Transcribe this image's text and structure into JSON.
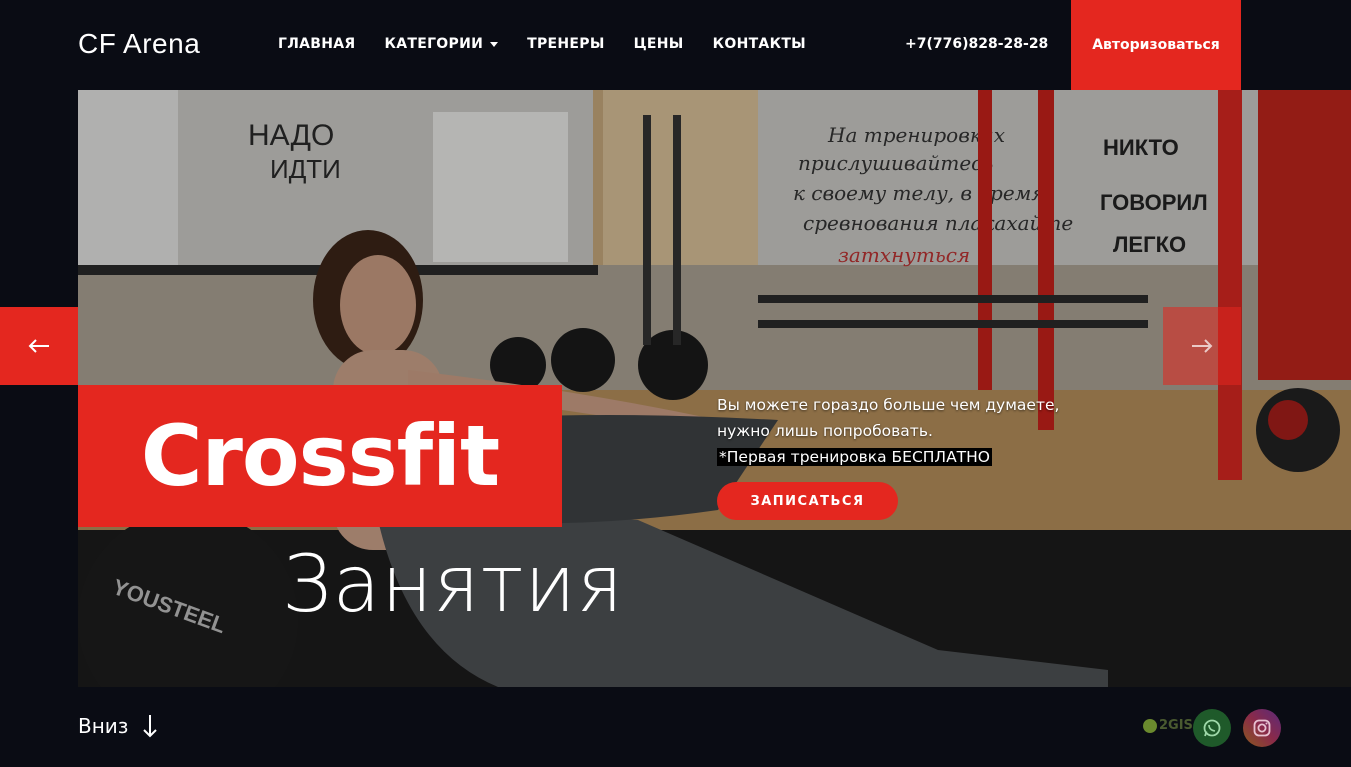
{
  "header": {
    "logo": "CF Arena",
    "nav": [
      {
        "label": "ГЛАВНАЯ",
        "dropdown": false
      },
      {
        "label": "КАТЕГОРИИ",
        "dropdown": true
      },
      {
        "label": "ТРЕНЕРЫ",
        "dropdown": false
      },
      {
        "label": "ЦЕНЫ",
        "dropdown": false
      },
      {
        "label": "КОНТАКТЫ",
        "dropdown": false
      }
    ],
    "phone": "+7(776)828-28-28",
    "auth_label": "Авторизоваться"
  },
  "hero": {
    "title": "Crossfit",
    "subtitle": "Занятия",
    "tagline_line1": "Вы можете гораздо больше чем думаете,",
    "tagline_line2": "нужно лишь попробовать.",
    "tagline_highlight": "*Первая тренировка БЕСПЛАТНО",
    "cta_label": "ЗАПИСАТЬСЯ",
    "prev_icon": "arrow-left-icon",
    "next_icon": "arrow-right-icon",
    "wall_text_1": "ЩЕНИ НАДО ИДТИ",
    "wall_text_2": "На тренировках прислушивайтесь к своему телу, в время сревнования плакахайте затхнуться",
    "wall_text_3": "НИКТО НЕ ГОВОРИЛ ЛЕГКО",
    "ball_text": "YOUSTEEL"
  },
  "footer": {
    "down_label": "Вниз",
    "gis_label": "2GIS",
    "social": [
      "whatsapp-icon",
      "instagram-icon"
    ]
  },
  "colors": {
    "accent": "#e4271f",
    "background": "#0a0c14"
  }
}
